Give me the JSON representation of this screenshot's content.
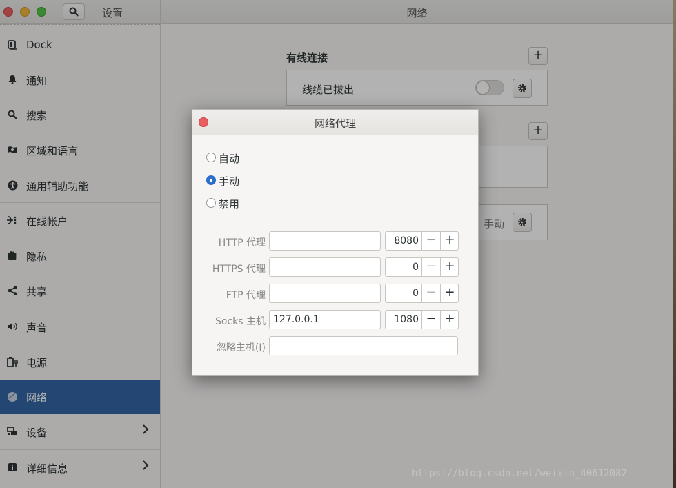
{
  "titlebar": {
    "settings_title": "设置",
    "main_title": "网络"
  },
  "sidebar": {
    "items": [
      {
        "label": "Dock",
        "icon": "dock-icon"
      },
      {
        "label": "通知",
        "icon": "bell-icon"
      },
      {
        "label": "搜索",
        "icon": "search-icon"
      },
      {
        "label": "区域和语言",
        "icon": "region-icon"
      },
      {
        "label": "通用辅助功能",
        "icon": "accessibility-icon"
      },
      {
        "label": "在线帐户",
        "icon": "online-accounts-icon"
      },
      {
        "label": "隐私",
        "icon": "hand-icon"
      },
      {
        "label": "共享",
        "icon": "share-icon"
      },
      {
        "label": "声音",
        "icon": "speaker-icon"
      },
      {
        "label": "电源",
        "icon": "power-icon"
      },
      {
        "label": "网络",
        "icon": "network-icon",
        "active": true
      },
      {
        "label": "设备",
        "icon": "devices-icon",
        "has_submenu": true
      },
      {
        "label": "详细信息",
        "icon": "info-icon",
        "has_submenu": true
      }
    ]
  },
  "main": {
    "wired_title": "有线连接",
    "cable_status": "线缆已拔出",
    "proxy_mode_value": "手动"
  },
  "dialog": {
    "title": "网络代理",
    "modes": [
      {
        "label": "自动",
        "selected": false
      },
      {
        "label": "手动",
        "selected": true
      },
      {
        "label": "禁用",
        "selected": false
      }
    ],
    "rows": [
      {
        "label": "HTTP 代理",
        "host": "",
        "port": "8080"
      },
      {
        "label": "HTTPS 代理",
        "host": "",
        "port": "0"
      },
      {
        "label": "FTP 代理",
        "host": "",
        "port": "0"
      },
      {
        "label": "Socks 主机",
        "host": "127.0.0.1",
        "port": "1080"
      }
    ],
    "ignore_label": "忽略主机(I)",
    "ignore_value": ""
  },
  "watermark": "https://blog.csdn.net/weixin_40612082",
  "colors": {
    "accent": "#3465a4",
    "radio_on": "#2a6fcb",
    "close": "#e95f5f"
  }
}
